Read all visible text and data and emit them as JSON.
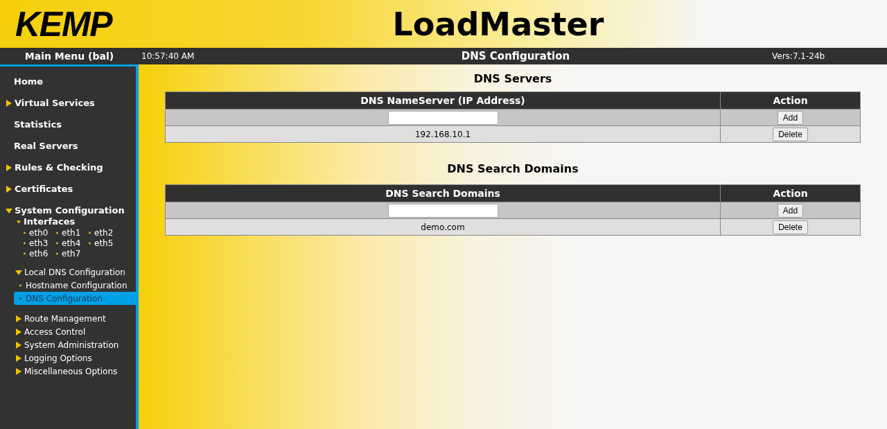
{
  "header": {
    "logo": "KEMP",
    "title": "LoadMaster"
  },
  "topbar": {
    "menu_title": "Main Menu (bal)",
    "time": "10:57:40 AM",
    "page_title": "DNS Configuration",
    "version": "Vers:7.1-24b"
  },
  "sidebar": {
    "items": [
      {
        "label": "Home"
      },
      {
        "label": "Virtual Services",
        "expanded": false
      },
      {
        "label": "Statistics"
      },
      {
        "label": "Real Servers"
      },
      {
        "label": "Rules & Checking",
        "expanded": false
      },
      {
        "label": "Certificates",
        "expanded": false
      },
      {
        "label": "System Configuration",
        "expanded": true,
        "children": [
          {
            "label": "Interfaces",
            "kind": "group",
            "expanded": true,
            "children": [
              {
                "label": "eth0"
              },
              {
                "label": "eth1"
              },
              {
                "label": "eth2"
              },
              {
                "label": "eth3"
              },
              {
                "label": "eth4"
              },
              {
                "label": "eth5"
              },
              {
                "label": "eth6"
              },
              {
                "label": "eth7"
              }
            ]
          },
          {
            "label": "Local DNS Configuration",
            "kind": "section",
            "expanded": true,
            "children": [
              {
                "label": "Hostname Configuration",
                "selected": false
              },
              {
                "label": "DNS Configuration",
                "selected": true
              }
            ]
          },
          {
            "label": "Route Management",
            "kind": "section",
            "expanded": false
          },
          {
            "label": "Access Control",
            "kind": "section",
            "expanded": false
          },
          {
            "label": "System Administration",
            "kind": "section",
            "expanded": false
          },
          {
            "label": "Logging Options",
            "kind": "section",
            "expanded": false
          },
          {
            "label": "Miscellaneous Options",
            "kind": "section",
            "expanded": false
          }
        ]
      }
    ]
  },
  "sections": [
    {
      "title": "DNS Servers",
      "columns": [
        "DNS NameServer (IP Address)",
        "Action"
      ],
      "add_button": "Add",
      "rows": [
        {
          "value": "192.168.10.1",
          "button": "Delete"
        }
      ]
    },
    {
      "title": "DNS Search Domains",
      "columns": [
        "DNS Search Domains",
        "Action"
      ],
      "add_button": "Add",
      "rows": [
        {
          "value": "demo.com",
          "button": "Delete"
        }
      ]
    }
  ]
}
